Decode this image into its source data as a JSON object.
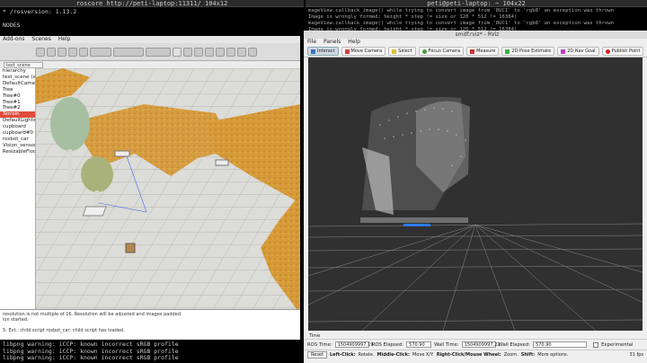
{
  "left_terminal": {
    "title": "roscore http://peti-laptop:11311/ 104x12",
    "lines": [
      "* /rosversion: 1.13.2",
      "",
      "NODES"
    ]
  },
  "right_terminal": {
    "title": "peti@peti-laptop: ~ 104x22",
    "lines": [
      "mageView.callback_image() while trying to convert image from '8UC1' to 'rgb8' an exception was thrown",
      "Image is wrongly formed: height * step != size  or  120 * 512 != 16384)",
      "mageView.callback_image() while trying to convert image from '8UC1' to 'rgb8' an exception was thrown",
      "Image is wrongly formed: height * step != size  or  120 * 512 != 16384)"
    ]
  },
  "vrep": {
    "menu": [
      "Add-ons",
      "Scenes",
      "Help"
    ],
    "tab": "test_scene",
    "tree": [
      {
        "label": "hierarchy",
        "sel": false
      },
      {
        "label": "test_scene (scene",
        "sel": false
      },
      {
        "label": "DefaultCamera",
        "sel": false
      },
      {
        "label": "Tree",
        "sel": false
      },
      {
        "label": "Tree#0",
        "sel": false
      },
      {
        "label": "Tree#1",
        "sel": false
      },
      {
        "label": "Tree#2",
        "sel": false
      },
      {
        "label": "Terrain",
        "sel": true
      },
      {
        "label": "DefaultLights",
        "sel": false
      },
      {
        "label": "cupboard",
        "sel": false
      },
      {
        "label": "cupboard#0",
        "sel": false
      },
      {
        "label": "rosbot_car",
        "sel": false
      },
      {
        "label": "Vision_sensor",
        "sel": false
      },
      {
        "label": "ResizableFloor",
        "sel": false
      }
    ],
    "console": [
      "resolution is not multiple of 16. Resolution will be adjusted and images padded.",
      "ion started.",
      "",
      "5: Ext.: child script rosbot_car: child script has loaded."
    ]
  },
  "bottom_terminal": {
    "lines": [
      "libpng warning: iCCP: known incorrect sRGB profile",
      "libpng warning: iCCP: known incorrect sRGB profile",
      "libpng warning: iCCP: known incorrect sRGB profile"
    ]
  },
  "rviz": {
    "title": "smdf.rviz* - RViz",
    "menu": [
      "File",
      "Panels",
      "Help"
    ],
    "tools": [
      "Interact",
      "Move Camera",
      "Select",
      "Focus Camera",
      "Measure",
      "2D Pose Estimate",
      "2D Nav Goal",
      "Publish Point"
    ],
    "time_panel_title": "Time",
    "ros_time_label": "ROS Time:",
    "ros_time": "1504909997.19",
    "ros_elapsed_label": "ROS Elapsed:",
    "ros_elapsed": "570.90",
    "wall_time_label": "Wall Time:",
    "wall_time": "1504909997.22",
    "wall_elapsed_label": "Wall Elapsed:",
    "wall_elapsed": "570.90",
    "experimental": "Experimental",
    "reset": "Reset",
    "hint_left": "Left-Click:",
    "hint_left_text": "Rotate.",
    "hint_middle": "Middle-Click:",
    "hint_middle_text": "Move X/Y.",
    "hint_right": "Right-Click/Mouse Wheel:",
    "hint_right_text": "Zoom.",
    "hint_shift": "Shift:",
    "hint_shift_text": "More options.",
    "fps": "31 fps"
  }
}
